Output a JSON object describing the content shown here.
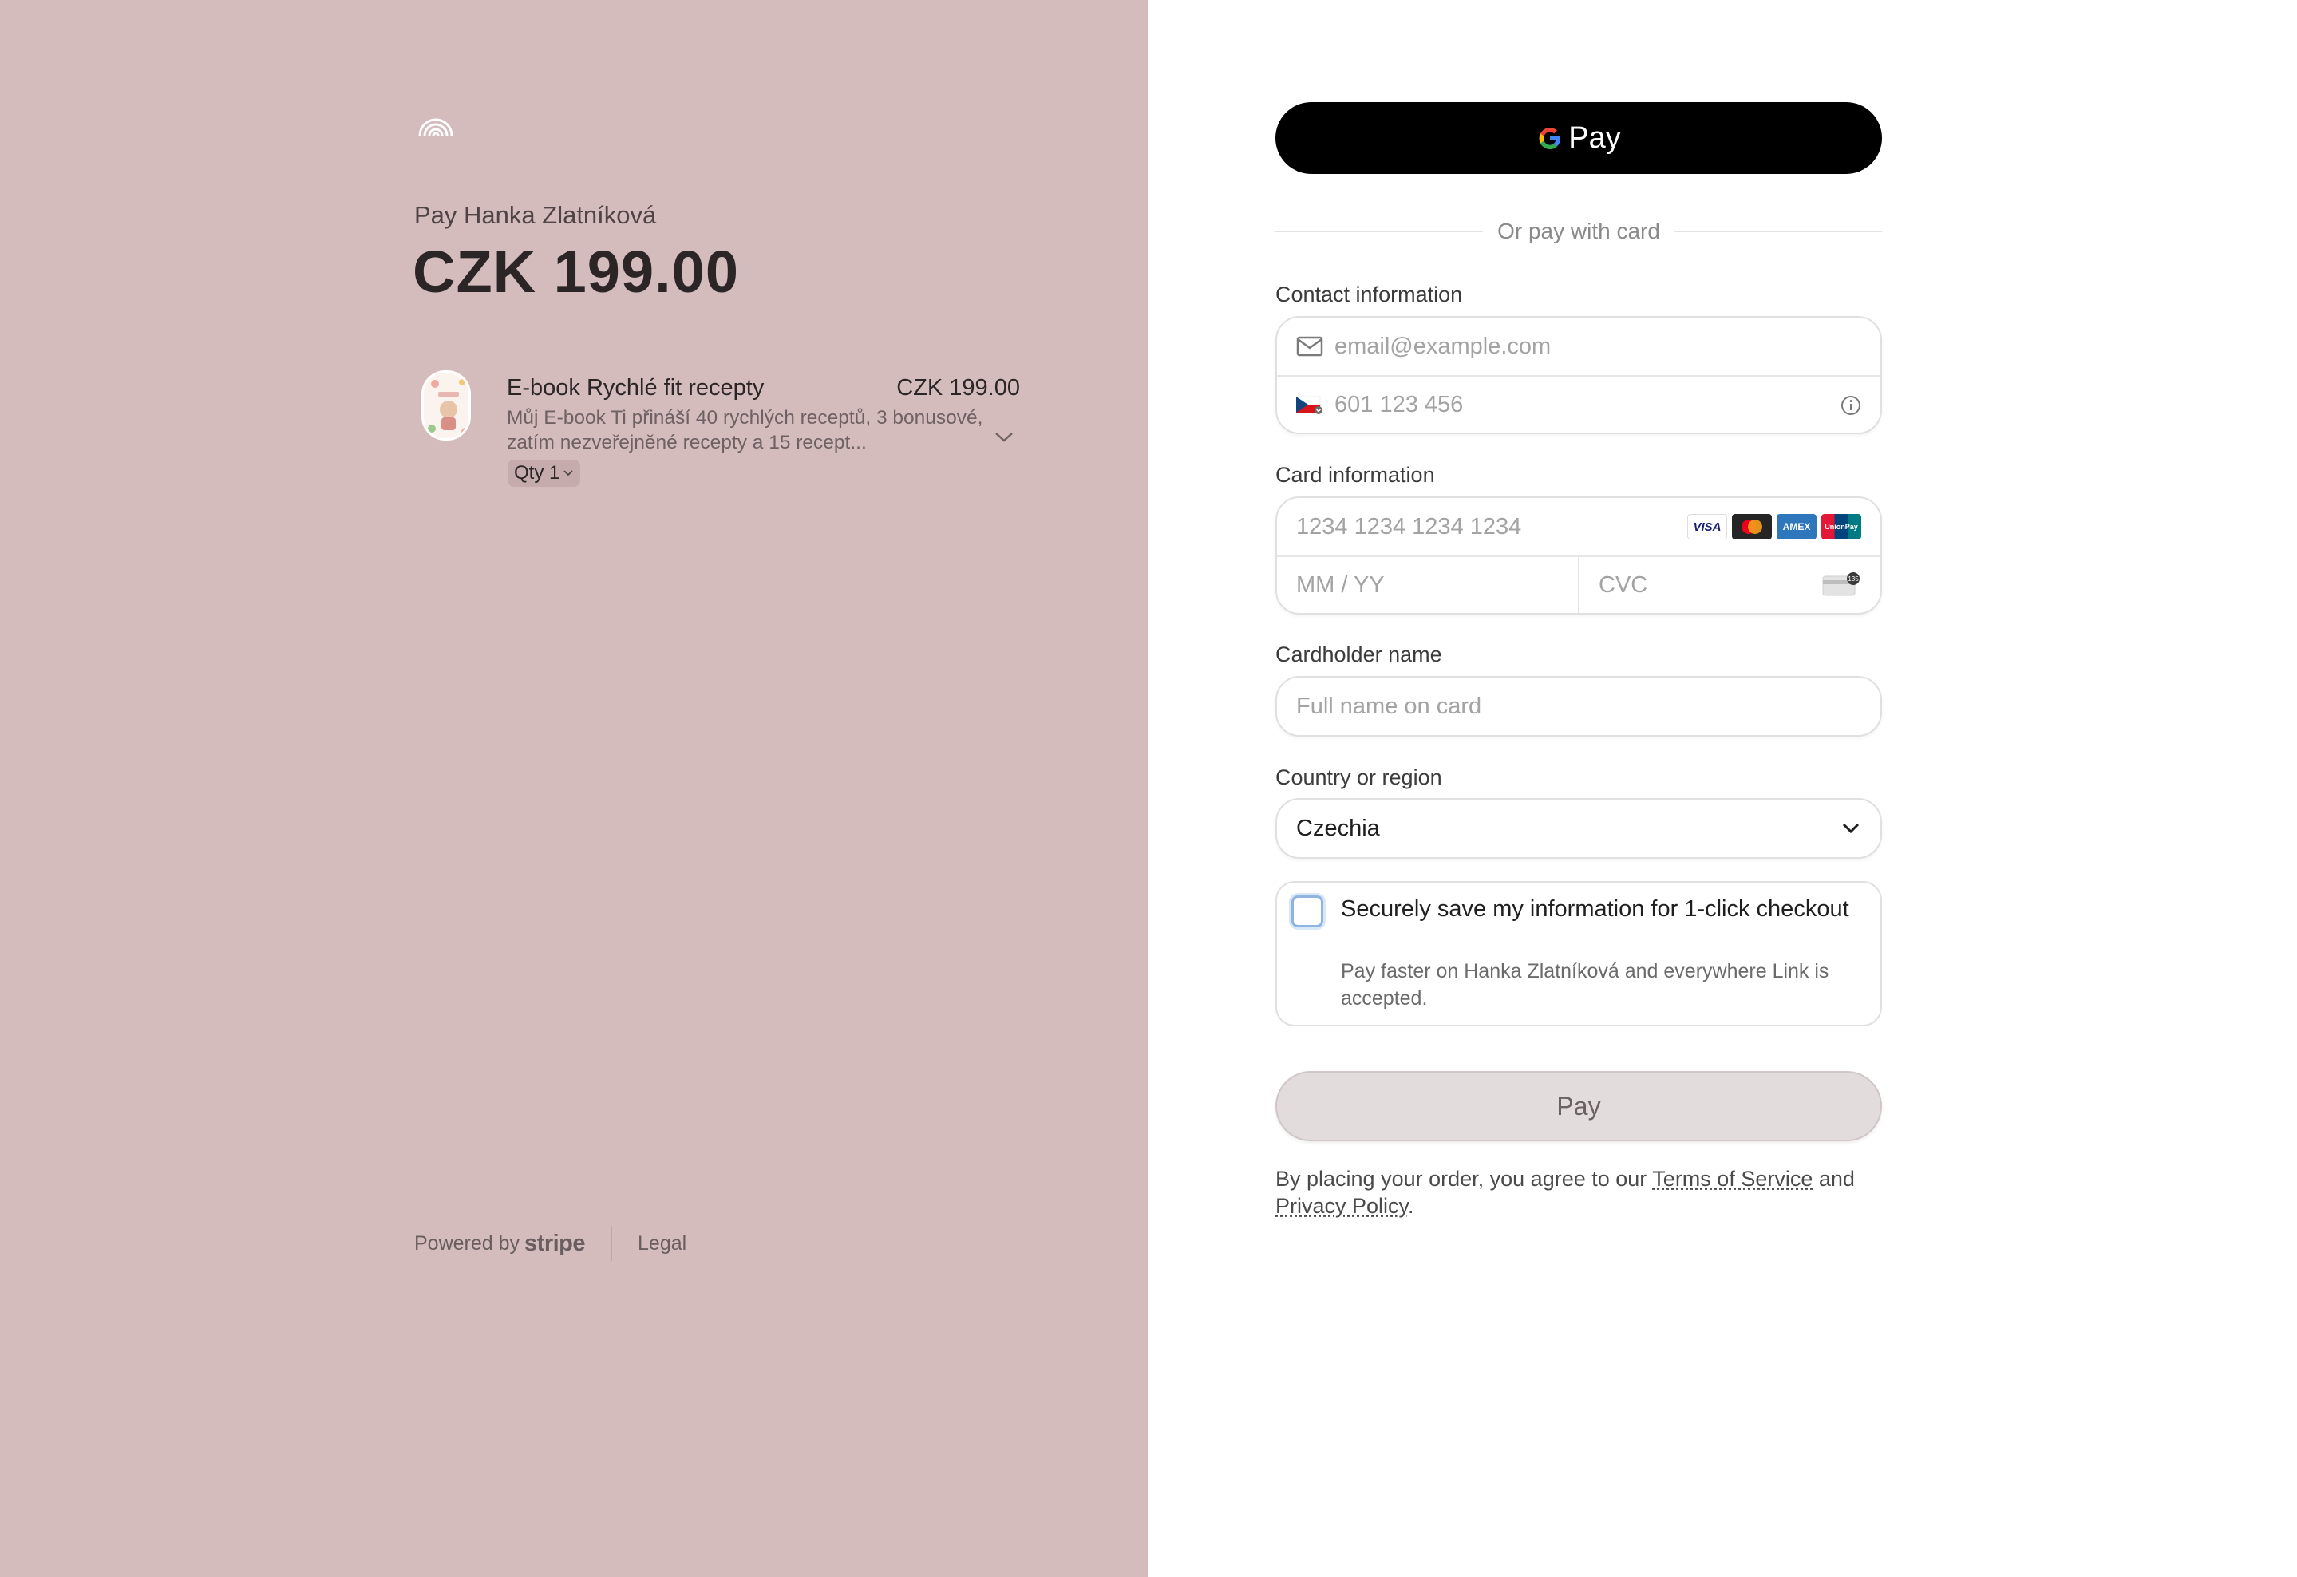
{
  "merchant": {
    "pay_to": "Pay Hanka Zlatníková",
    "amount": "CZK 199.00",
    "logo": "rainbow-logo-icon"
  },
  "line_item": {
    "name": "E-book Rychlé fit recepty",
    "price": "CZK 199.00",
    "description": "Můj E-book Ti přináší 40 rychlých receptů, 3 bonusové, zatím nezveřejněné recepty a 15 recept...",
    "qty_label": "Qty 1"
  },
  "footer": {
    "powered_by": "Powered by",
    "stripe": "stripe",
    "legal": "Legal"
  },
  "gpay": {
    "label": "Pay"
  },
  "divider_text": "Or pay with card",
  "contact": {
    "label": "Contact information",
    "email_placeholder": "email@example.com",
    "phone_placeholder": "601 123 456"
  },
  "card": {
    "label": "Card information",
    "number_placeholder": "1234 1234 1234 1234",
    "expiry_placeholder": "MM / YY",
    "cvc_placeholder": "CVC",
    "brands": [
      "VISA",
      "mastercard",
      "AMEX",
      "UnionPay"
    ]
  },
  "cardholder": {
    "label": "Cardholder name",
    "placeholder": "Full name on card"
  },
  "country": {
    "label": "Country or region",
    "value": "Czechia"
  },
  "save": {
    "title": "Securely save my information for 1-click checkout",
    "subtitle": "Pay faster on Hanka Zlatníková and everywhere Link is accepted."
  },
  "pay_button": "Pay",
  "terms": {
    "prefix": "By placing your order, you agree to our ",
    "tos": "Terms of Service",
    "and": " and ",
    "privacy": "Privacy Policy",
    "suffix": "."
  },
  "colors": {
    "left_bg": "#d4bcbd",
    "pay_button_bg": "#e3dcdd",
    "gpay_bg": "#000000"
  }
}
